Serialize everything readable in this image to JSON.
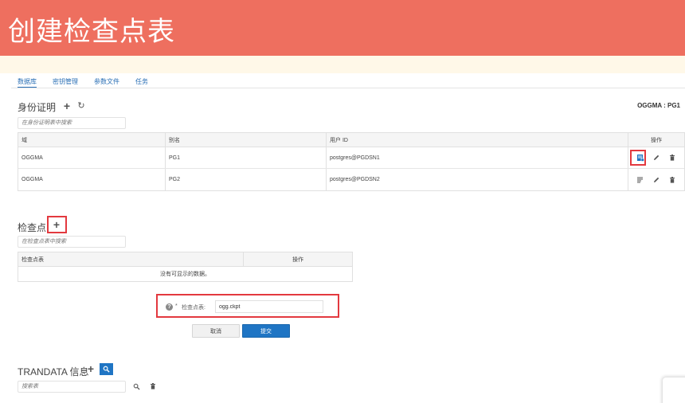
{
  "banner": {
    "title": "创建检查点表"
  },
  "tabs": [
    {
      "label": "数据库",
      "active": true
    },
    {
      "label": "密钥管理",
      "active": false
    },
    {
      "label": "参数文件",
      "active": false
    },
    {
      "label": "任务",
      "active": false
    }
  ],
  "credentials": {
    "title": "身份证明",
    "context_label": "OGGMA : PG1",
    "search_placeholder": "在身份证明表中搜索",
    "columns": [
      "域",
      "别名",
      "用户 ID",
      "操作"
    ],
    "rows": [
      {
        "domain": "OGGMA",
        "alias": "PG1",
        "user_id": "postgres@PGDSN1"
      },
      {
        "domain": "OGGMA",
        "alias": "PG2",
        "user_id": "postgres@PGDSN2"
      }
    ]
  },
  "checkpoint": {
    "title": "检查点",
    "search_placeholder": "在检查点表中搜索",
    "columns": [
      "检查点表",
      "操作"
    ],
    "empty_text": "没有可显示的数据。",
    "form": {
      "required_mark": "*",
      "label": "检查点表:",
      "value": "ogg.ckpt",
      "cancel_label": "取消",
      "submit_label": "提交"
    }
  },
  "trandata": {
    "title": "TRANDATA 信息",
    "search_placeholder": "搜索表"
  },
  "colors": {
    "banner": "#ee6f5f",
    "accent": "#1f75c4",
    "highlight": "#e3393f"
  },
  "icons": {
    "add": "plus-icon",
    "refresh": "refresh-icon",
    "connect": "database-connect-icon",
    "edit": "pencil-icon",
    "delete": "trash-icon",
    "search": "magnifier-icon"
  }
}
